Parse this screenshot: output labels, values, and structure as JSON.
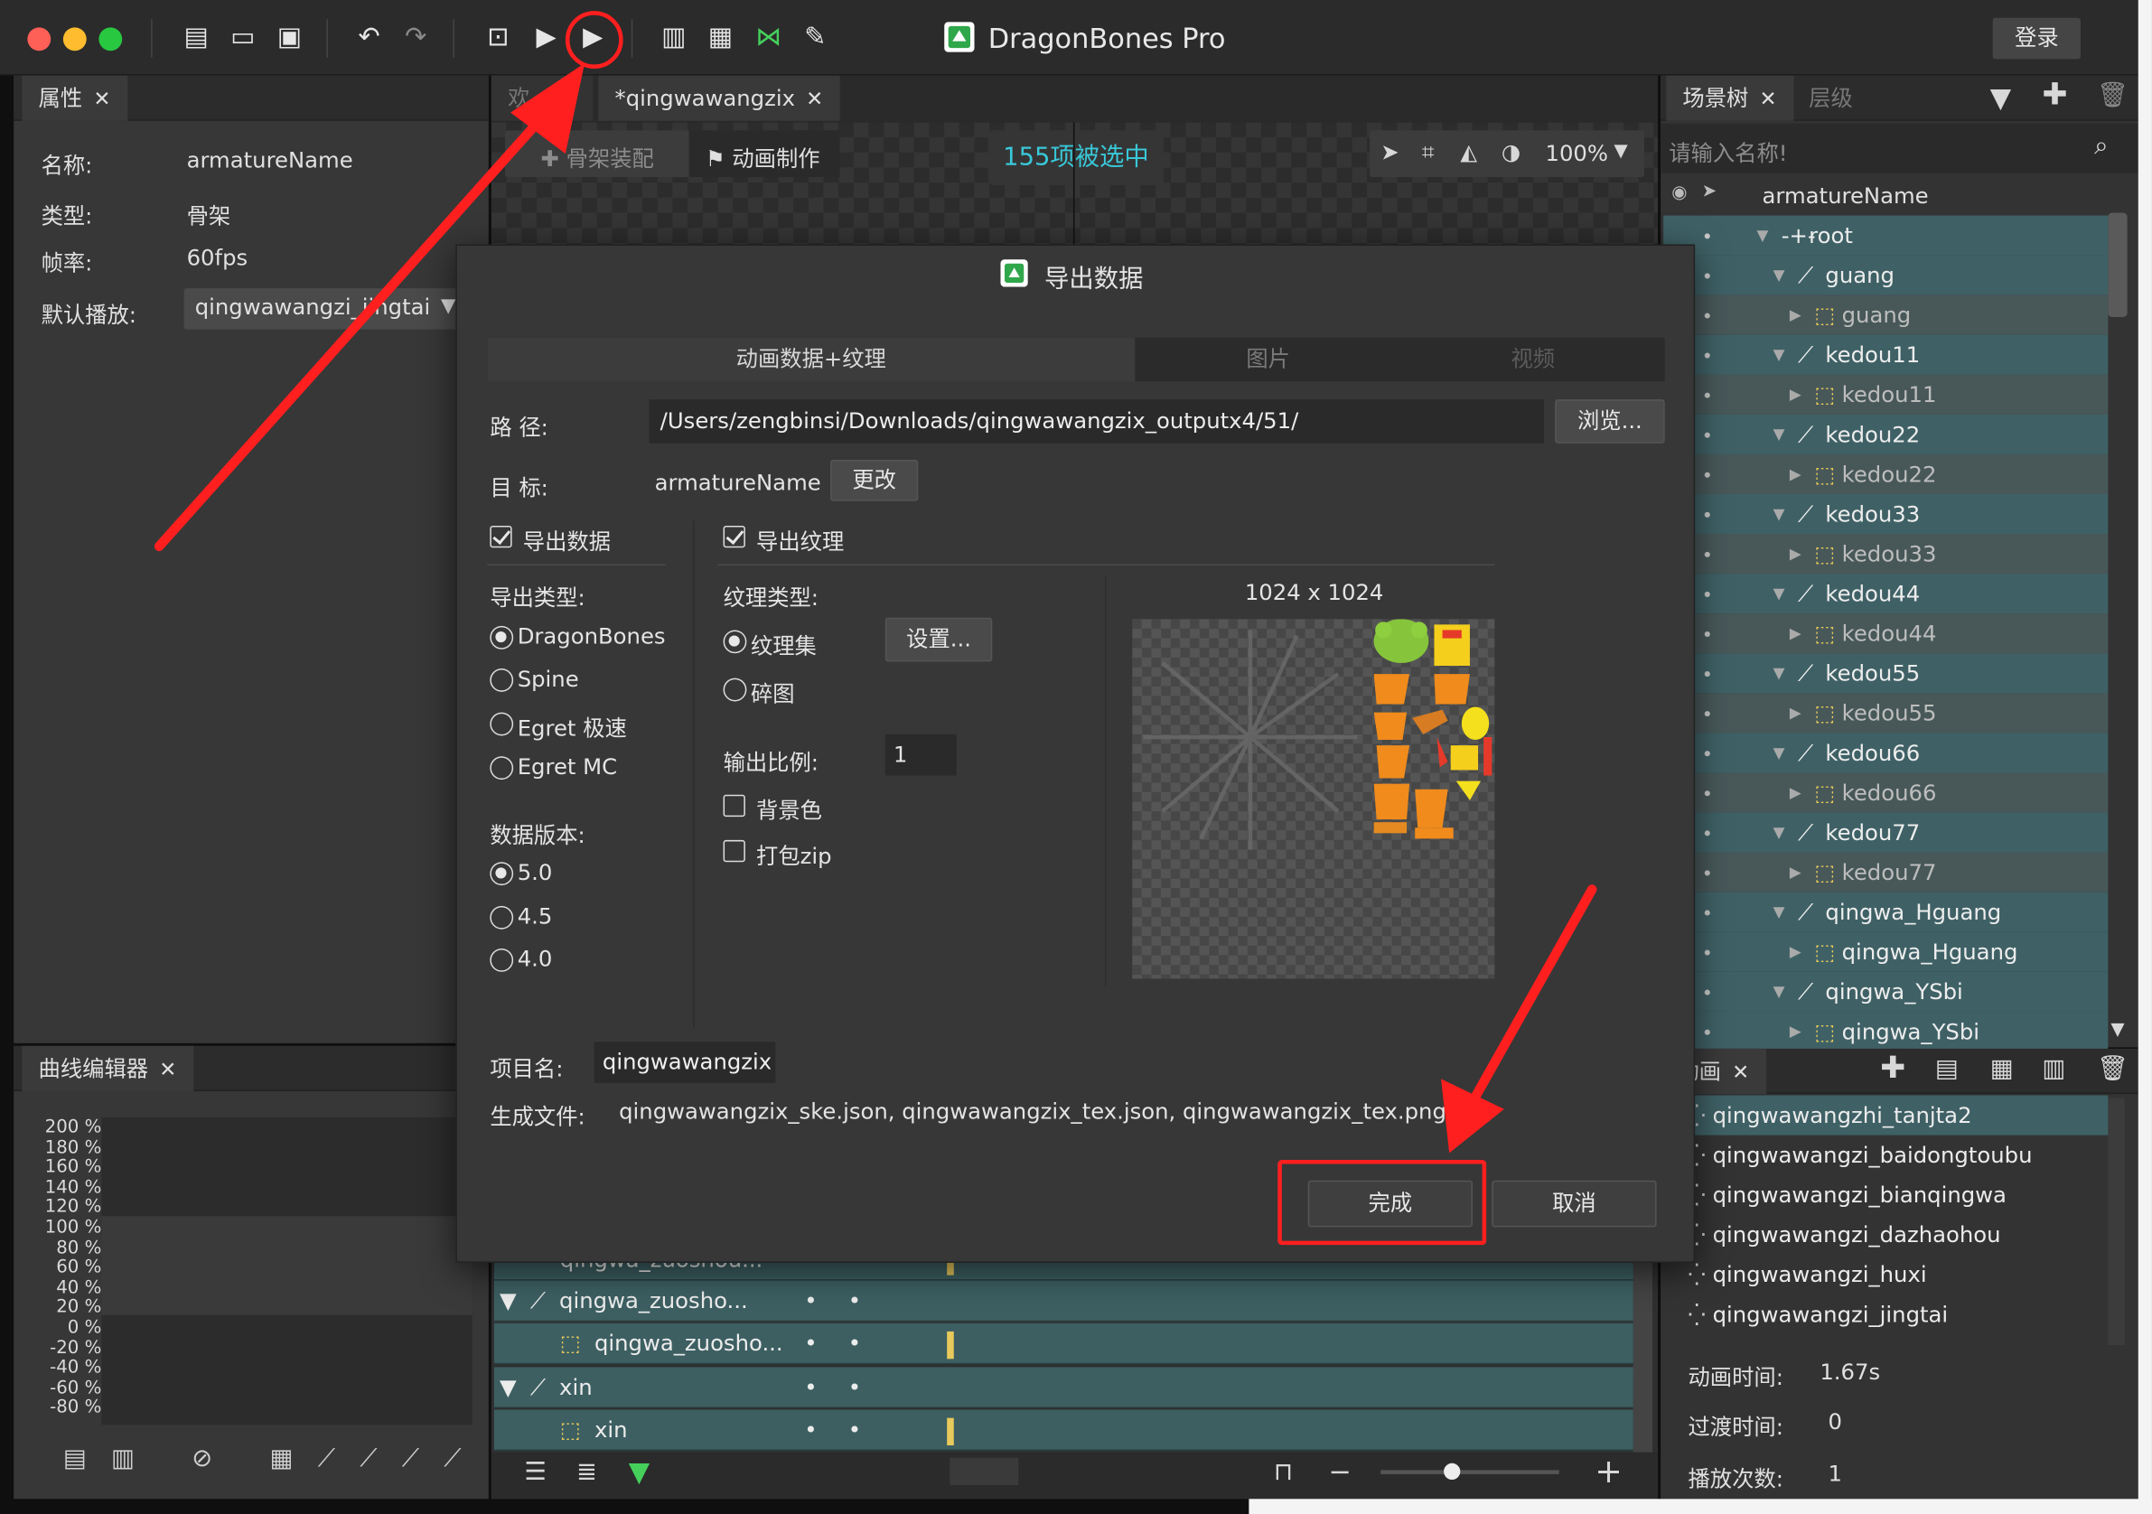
{
  "app": {
    "title": "DragonBones Pro",
    "login_label": "登录"
  },
  "properties": {
    "tab": "属性",
    "name_label": "名称:",
    "name_value": "armatureName",
    "type_label": "类型:",
    "type_value": "骨架",
    "fps_label": "帧率:",
    "fps_value": "60fps",
    "default_label": "默认播放:",
    "default_value": "qingwawangzi_jingtai"
  },
  "editor": {
    "tab_partial": "欢",
    "tab_active": "*qingwawangzix",
    "mode_rig": "骨架装配",
    "mode_anim": "动画制作",
    "selected_badge": "155项被选中",
    "zoom": "100%"
  },
  "curve": {
    "tab": "曲线编辑器",
    "ticks": [
      "200 %",
      "180 %",
      "160 %",
      "140 %",
      "120 %",
      "100 %",
      "80 %",
      "60 %",
      "40 %",
      "20 %",
      "0 %",
      "-20 %",
      "-40 %",
      "-60 %",
      "-80 %"
    ]
  },
  "scene_tree": {
    "tab_scene": "场景树",
    "tab_layer": "层级",
    "search_placeholder": "请输入名称!",
    "root_name": "armatureName",
    "items": [
      {
        "label": "root",
        "type": "bone",
        "shade": "dark"
      },
      {
        "label": "guang",
        "type": "bone",
        "shade": "dark"
      },
      {
        "label": "guang",
        "type": "slot",
        "shade": "light"
      },
      {
        "label": "kedou11",
        "type": "bone",
        "shade": "dark"
      },
      {
        "label": "kedou11",
        "type": "slot",
        "shade": "light"
      },
      {
        "label": "kedou22",
        "type": "bone",
        "shade": "dark"
      },
      {
        "label": "kedou22",
        "type": "slot",
        "shade": "light"
      },
      {
        "label": "kedou33",
        "type": "bone",
        "shade": "dark"
      },
      {
        "label": "kedou33",
        "type": "slot",
        "shade": "light"
      },
      {
        "label": "kedou44",
        "type": "bone",
        "shade": "dark"
      },
      {
        "label": "kedou44",
        "type": "slot",
        "shade": "light"
      },
      {
        "label": "kedou55",
        "type": "bone",
        "shade": "dark"
      },
      {
        "label": "kedou55",
        "type": "slot",
        "shade": "light"
      },
      {
        "label": "kedou66",
        "type": "bone",
        "shade": "dark"
      },
      {
        "label": "kedou66",
        "type": "slot",
        "shade": "light"
      },
      {
        "label": "kedou77",
        "type": "bone",
        "shade": "dark"
      },
      {
        "label": "kedou77",
        "type": "slot",
        "shade": "light"
      },
      {
        "label": "qingwa_Hguang",
        "type": "bone",
        "shade": "dark"
      },
      {
        "label": "qingwa_Hguang",
        "type": "slot",
        "shade": "dark"
      },
      {
        "label": "qingwa_YSbi",
        "type": "bone",
        "shade": "dark"
      },
      {
        "label": "qingwa_YSbi",
        "type": "slot",
        "shade": "dark"
      }
    ]
  },
  "animation": {
    "tab": "动画",
    "items": [
      "qingwawangzhi_tanjta2",
      "qingwawangzi_baidongtoubu",
      "qingwawangzi_bianqingwa",
      "qingwawangzi_dazhaohou",
      "qingwawangzi_huxi",
      "qingwawangzi_jingtai"
    ],
    "duration_label": "动画时间:",
    "duration_value": "1.67s",
    "fade_label": "过渡时间:",
    "fade_value": "0",
    "play_label": "播放次数:",
    "play_value": "1"
  },
  "timeline": {
    "rows": [
      {
        "label": "qingwa_zuoshou...",
        "type": "slot"
      },
      {
        "label": "qingwa_zuosho...",
        "type": "bone"
      },
      {
        "label": "qingwa_zuosho...",
        "type": "slot"
      },
      {
        "label": "xin",
        "type": "bone"
      },
      {
        "label": "xin",
        "type": "slot"
      }
    ]
  },
  "dialog": {
    "title": "导出数据",
    "tabs": [
      "动画数据+纹理",
      "图片",
      "视频"
    ],
    "path_label": "路 径:",
    "path_value": "/Users/zengbinsi/Downloads/qingwawangzix_outputx4/51/",
    "browse": "浏览...",
    "target_label": "目 标:",
    "target_value": "armatureName",
    "change": "更改",
    "export_data": "导出数据",
    "export_texture": "导出纹理",
    "export_type_label": "导出类型:",
    "export_types": [
      "DragonBones",
      "Spine",
      "Egret 极速",
      "Egret MC"
    ],
    "data_version_label": "数据版本:",
    "data_versions": [
      "5.0",
      "4.5",
      "4.0"
    ],
    "texture_type_label": "纹理类型:",
    "texture_atlas": "纹理集",
    "texture_fragments": "碎图",
    "settings": "设置...",
    "scale_label": "输出比例:",
    "scale_value": "1",
    "bg_color": "背景色",
    "zip": "打包zip",
    "preview_size": "1024 x 1024",
    "project_label": "项目名:",
    "project_value": "qingwawangzix",
    "files_label": "生成文件:",
    "files_value": "qingwawangzix_ske.json, qingwawangzix_tex.json, qingwawangzix_tex.png",
    "ok": "完成",
    "cancel": "取消"
  },
  "colors": {
    "accent_teal": "#3f6166",
    "highlight_red": "#ff1f1f",
    "badge_text": "#39c8d8",
    "keyframe": "#e8c95b"
  }
}
